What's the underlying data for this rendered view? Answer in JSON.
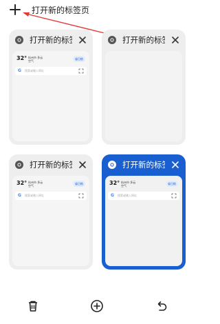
{
  "top": {
    "new_tab_label": "打开新的标签页"
  },
  "tabs": [
    {
      "title": "打开新的标签页",
      "active": false,
      "has_preview": true
    },
    {
      "title": "打开新的标签页",
      "active": false,
      "has_preview": false
    },
    {
      "title": "打开新的标签页",
      "active": false,
      "has_preview": true
    },
    {
      "title": "打开新的标签页",
      "active": true,
      "has_preview": true
    }
  ],
  "preview": {
    "temperature": "32°",
    "weather_line1": "杭州市 多云",
    "weather_line2": "空气",
    "pill_label": "省日航",
    "search_placeholder": "搜索或输入网址"
  },
  "colors": {
    "accent": "#1a5fd0",
    "annotation": "#e53935",
    "card_bg": "#eeeeee"
  },
  "bottom": {
    "icons": [
      "trash-icon",
      "add-circle-icon",
      "undo-icon"
    ]
  }
}
